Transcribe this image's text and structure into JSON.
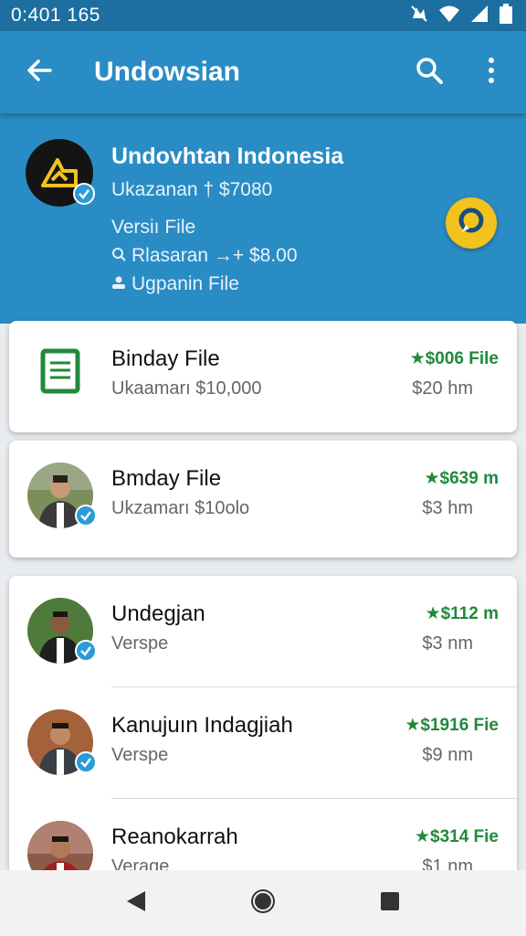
{
  "status_bar": {
    "time": "0:401 165",
    "icons": [
      "mute-icon",
      "wifi-icon",
      "signal-icon",
      "battery-icon"
    ]
  },
  "app_bar": {
    "title": "Undowsian",
    "icons": [
      "back-arrow-icon",
      "search-icon",
      "more-vert-icon"
    ]
  },
  "header": {
    "name": "Undovhtan Indonesia",
    "subtitle": "Ukazanan † $7080",
    "section_label": "Versiı File",
    "line1": "Rlasaran →+ $8.00",
    "line1_icon": "search-icon",
    "line2": "Ugpanin File",
    "line2_icon": "person-icon",
    "fab_icon": "chat-icon"
  },
  "cards": [
    {
      "rows": [
        {
          "title": "Binday File",
          "subtitle": "Ukaamarı $10,000",
          "price": "★$006 File",
          "time": "$20 hm",
          "icon": "document-icon"
        }
      ]
    },
    {
      "rows": [
        {
          "title": "Bmday File",
          "subtitle": "Ukzamarı $10olo",
          "price": "★$639 m",
          "time": "$3 hm",
          "icon": "avatar"
        }
      ]
    },
    {
      "rows": [
        {
          "title": "Undegjan",
          "subtitle": "Verspe",
          "price": "★$112 m",
          "time": "$3 nm",
          "icon": "avatar"
        },
        {
          "title": "Kanujuın Indagjiah",
          "subtitle": "Verspe",
          "price": "★$1916 Fie",
          "time": "$9 nm",
          "icon": "avatar"
        },
        {
          "title": "Reanokarrah",
          "subtitle": "Verage",
          "price": "★$314 Fie",
          "time": "$1 nm",
          "icon": "avatar"
        }
      ]
    }
  ],
  "nav_bar": {
    "icons": [
      "back-triangle-icon",
      "home-circle-icon",
      "recents-square-icon"
    ]
  },
  "colors": {
    "primary": "#2a8cc4",
    "status": "#1c6fa0",
    "accent_green": "#1f8a3a",
    "fab": "#f2c21d"
  }
}
